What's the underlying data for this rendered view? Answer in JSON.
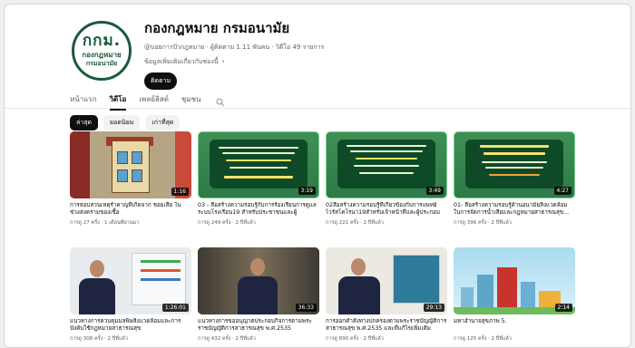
{
  "channel": {
    "logo": {
      "line1": "กกม.",
      "line2": "กองกฎหมาย",
      "line3": "กรมอนามัย"
    },
    "name": "กองกฎหมาย กรมอนามัย",
    "meta": "@บอยการปัวกฎหมาย · ผู้ติดตาม 1.11 พันคน · วิดีโอ 49 รายการ",
    "more": "ข้อมูลเพิ่มเติมเกี่ยวกับช่องนี้",
    "subscribe": "ติดตาม"
  },
  "tabs": [
    {
      "label": "หน้าแรก",
      "active": false
    },
    {
      "label": "วิดีโอ",
      "active": true
    },
    {
      "label": "เพลย์ลิสต์",
      "active": false
    },
    {
      "label": "ชุมชน",
      "active": false
    }
  ],
  "chips": [
    {
      "label": "ล่าสุด",
      "active": true
    },
    {
      "label": "ยอดนิยม",
      "active": false
    },
    {
      "label": "เก่าที่สุด",
      "active": false
    }
  ],
  "videos": [
    {
      "title": "การสอบสวนเหตุรำคาญที่เกิดจาก ชอยเสีย ใน ช่วงสงครามของเชื้อ",
      "meta": "การดู 27 ครั้ง · 1 เดือนที่ผ่านมา",
      "duration": "1:16"
    },
    {
      "title": "03 - สื่อสร้างความรอบรู้กับการร้องเรียนการดูแลระบบโรงเรือน19 สำหรับประชาชนและผู้ประกอบ...",
      "meta": "การดู 249 ครั้ง · 2 ปีที่แล้ว",
      "duration": "3:19"
    },
    {
      "title": "02สื่อสร้างความรอบรู้ที่เกี่ยวข้องกับการแพทย์ไวรัสโคโรนา19สำหรับเจ้าหน้าที่และผู้ประกอบการ...",
      "meta": "การดู 221 ครั้ง · 2 ปีที่แล้ว",
      "duration": "3:49"
    },
    {
      "title": "01- สื่อสร้างความรอบรู้ด้านอนามัยสิ่งแวดล้อม ในการจัดการน้ำเสียและกฎหมายสาธารณสุข...",
      "meta": "การดู 396 ครั้ง · 2 ปีที่แล้ว",
      "duration": "4:27"
    },
    {
      "title": "แนวทางการควบคุมมลพิษสิ่งแวดล้อมและการบังคับใช้กฎหมายสาธารณสุข",
      "meta": "การดู 308 ครั้ง · 2 ปีที่แล้ว",
      "duration": "1:26:01"
    },
    {
      "title": "แนวทางการขออนุญาตประกอบกิจการตามพระราชบัญญัติการสาธารณสุข พ.ศ.2535",
      "meta": "การดู 432 ครั้ง · 2 ปีที่แล้ว",
      "duration": "36:33"
    },
    {
      "title": "การออกคำสั่งทางปกครองตามพระราชบัญญัติการสาธารณสุข พ.ศ.2535 และที่แก้ไขเพิ่มเติม",
      "meta": "การดู 890 ครั้ง · 2 ปีที่แล้ว",
      "duration": "29:13"
    },
    {
      "title": "มหาอำนาจสุขภาพ 5.",
      "meta": "การดู 125 ครั้ง · 2 ปีที่แล้ว",
      "duration": "2:14"
    }
  ],
  "colors": {
    "accent": "#0f0f0f",
    "green_slide": "#2f7a48",
    "logo_green": "#1b5a3a"
  }
}
